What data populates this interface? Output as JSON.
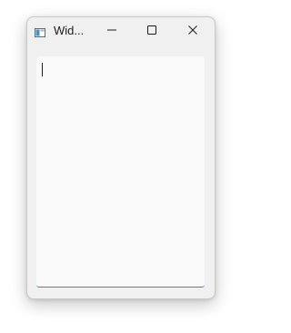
{
  "window": {
    "title": "Wid...",
    "icon": "window-app-icon",
    "controls": {
      "minimize_icon": "minimize-icon",
      "maximize_icon": "maximize-icon",
      "close_icon": "close-icon"
    }
  },
  "editor": {
    "value": "",
    "focused": true,
    "accent_color": "#2f8fbd"
  }
}
